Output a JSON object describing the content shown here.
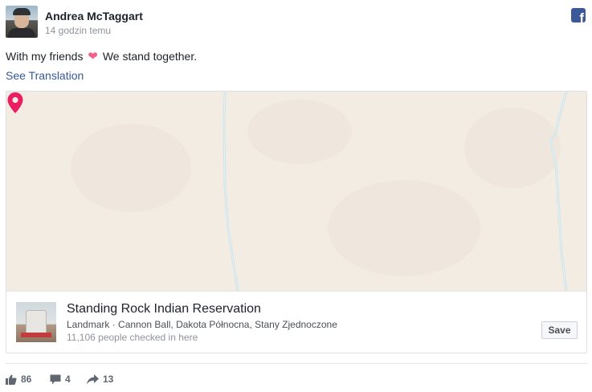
{
  "post": {
    "author": "Andrea McTaggart",
    "timestamp": "14 godzin temu",
    "text_before_heart": "With my friends",
    "text_after_heart": "We stand together.",
    "heart_glyph": "❤",
    "see_translation": "See Translation"
  },
  "network_icon": {
    "name": "facebook-icon",
    "glyph": "f",
    "color": "#3b5998"
  },
  "place": {
    "name": "Standing Rock Indian Reservation",
    "meta": "Landmark · Cannon Ball, Dakota Północna, Stany Zjednoczone",
    "checkins": "11,106 people checked in here",
    "save_label": "Save"
  },
  "map": {
    "pin_color": "#e91e63",
    "background": "#f3ece3"
  },
  "stats": {
    "likes": "86",
    "comments": "4",
    "shares": "13"
  },
  "colors": {
    "link": "#365899",
    "text": "#1d2129",
    "muted": "#90949c"
  }
}
